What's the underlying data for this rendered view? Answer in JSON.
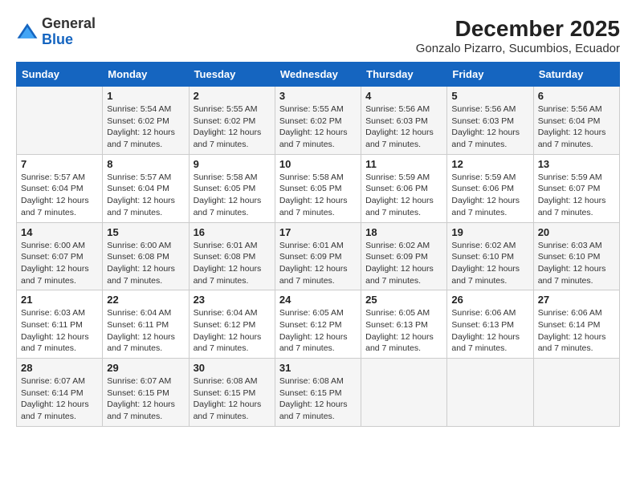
{
  "logo": {
    "general": "General",
    "blue": "Blue"
  },
  "header": {
    "month_year": "December 2025",
    "location": "Gonzalo Pizarro, Sucumbios, Ecuador"
  },
  "days_of_week": [
    "Sunday",
    "Monday",
    "Tuesday",
    "Wednesday",
    "Thursday",
    "Friday",
    "Saturday"
  ],
  "weeks": [
    [
      {
        "day": "",
        "sunrise": "",
        "sunset": "",
        "daylight": ""
      },
      {
        "day": "1",
        "sunrise": "Sunrise: 5:54 AM",
        "sunset": "Sunset: 6:02 PM",
        "daylight": "Daylight: 12 hours and 7 minutes."
      },
      {
        "day": "2",
        "sunrise": "Sunrise: 5:55 AM",
        "sunset": "Sunset: 6:02 PM",
        "daylight": "Daylight: 12 hours and 7 minutes."
      },
      {
        "day": "3",
        "sunrise": "Sunrise: 5:55 AM",
        "sunset": "Sunset: 6:02 PM",
        "daylight": "Daylight: 12 hours and 7 minutes."
      },
      {
        "day": "4",
        "sunrise": "Sunrise: 5:56 AM",
        "sunset": "Sunset: 6:03 PM",
        "daylight": "Daylight: 12 hours and 7 minutes."
      },
      {
        "day": "5",
        "sunrise": "Sunrise: 5:56 AM",
        "sunset": "Sunset: 6:03 PM",
        "daylight": "Daylight: 12 hours and 7 minutes."
      },
      {
        "day": "6",
        "sunrise": "Sunrise: 5:56 AM",
        "sunset": "Sunset: 6:04 PM",
        "daylight": "Daylight: 12 hours and 7 minutes."
      }
    ],
    [
      {
        "day": "7",
        "sunrise": "Sunrise: 5:57 AM",
        "sunset": "Sunset: 6:04 PM",
        "daylight": "Daylight: 12 hours and 7 minutes."
      },
      {
        "day": "8",
        "sunrise": "Sunrise: 5:57 AM",
        "sunset": "Sunset: 6:04 PM",
        "daylight": "Daylight: 12 hours and 7 minutes."
      },
      {
        "day": "9",
        "sunrise": "Sunrise: 5:58 AM",
        "sunset": "Sunset: 6:05 PM",
        "daylight": "Daylight: 12 hours and 7 minutes."
      },
      {
        "day": "10",
        "sunrise": "Sunrise: 5:58 AM",
        "sunset": "Sunset: 6:05 PM",
        "daylight": "Daylight: 12 hours and 7 minutes."
      },
      {
        "day": "11",
        "sunrise": "Sunrise: 5:59 AM",
        "sunset": "Sunset: 6:06 PM",
        "daylight": "Daylight: 12 hours and 7 minutes."
      },
      {
        "day": "12",
        "sunrise": "Sunrise: 5:59 AM",
        "sunset": "Sunset: 6:06 PM",
        "daylight": "Daylight: 12 hours and 7 minutes."
      },
      {
        "day": "13",
        "sunrise": "Sunrise: 5:59 AM",
        "sunset": "Sunset: 6:07 PM",
        "daylight": "Daylight: 12 hours and 7 minutes."
      }
    ],
    [
      {
        "day": "14",
        "sunrise": "Sunrise: 6:00 AM",
        "sunset": "Sunset: 6:07 PM",
        "daylight": "Daylight: 12 hours and 7 minutes."
      },
      {
        "day": "15",
        "sunrise": "Sunrise: 6:00 AM",
        "sunset": "Sunset: 6:08 PM",
        "daylight": "Daylight: 12 hours and 7 minutes."
      },
      {
        "day": "16",
        "sunrise": "Sunrise: 6:01 AM",
        "sunset": "Sunset: 6:08 PM",
        "daylight": "Daylight: 12 hours and 7 minutes."
      },
      {
        "day": "17",
        "sunrise": "Sunrise: 6:01 AM",
        "sunset": "Sunset: 6:09 PM",
        "daylight": "Daylight: 12 hours and 7 minutes."
      },
      {
        "day": "18",
        "sunrise": "Sunrise: 6:02 AM",
        "sunset": "Sunset: 6:09 PM",
        "daylight": "Daylight: 12 hours and 7 minutes."
      },
      {
        "day": "19",
        "sunrise": "Sunrise: 6:02 AM",
        "sunset": "Sunset: 6:10 PM",
        "daylight": "Daylight: 12 hours and 7 minutes."
      },
      {
        "day": "20",
        "sunrise": "Sunrise: 6:03 AM",
        "sunset": "Sunset: 6:10 PM",
        "daylight": "Daylight: 12 hours and 7 minutes."
      }
    ],
    [
      {
        "day": "21",
        "sunrise": "Sunrise: 6:03 AM",
        "sunset": "Sunset: 6:11 PM",
        "daylight": "Daylight: 12 hours and 7 minutes."
      },
      {
        "day": "22",
        "sunrise": "Sunrise: 6:04 AM",
        "sunset": "Sunset: 6:11 PM",
        "daylight": "Daylight: 12 hours and 7 minutes."
      },
      {
        "day": "23",
        "sunrise": "Sunrise: 6:04 AM",
        "sunset": "Sunset: 6:12 PM",
        "daylight": "Daylight: 12 hours and 7 minutes."
      },
      {
        "day": "24",
        "sunrise": "Sunrise: 6:05 AM",
        "sunset": "Sunset: 6:12 PM",
        "daylight": "Daylight: 12 hours and 7 minutes."
      },
      {
        "day": "25",
        "sunrise": "Sunrise: 6:05 AM",
        "sunset": "Sunset: 6:13 PM",
        "daylight": "Daylight: 12 hours and 7 minutes."
      },
      {
        "day": "26",
        "sunrise": "Sunrise: 6:06 AM",
        "sunset": "Sunset: 6:13 PM",
        "daylight": "Daylight: 12 hours and 7 minutes."
      },
      {
        "day": "27",
        "sunrise": "Sunrise: 6:06 AM",
        "sunset": "Sunset: 6:14 PM",
        "daylight": "Daylight: 12 hours and 7 minutes."
      }
    ],
    [
      {
        "day": "28",
        "sunrise": "Sunrise: 6:07 AM",
        "sunset": "Sunset: 6:14 PM",
        "daylight": "Daylight: 12 hours and 7 minutes."
      },
      {
        "day": "29",
        "sunrise": "Sunrise: 6:07 AM",
        "sunset": "Sunset: 6:15 PM",
        "daylight": "Daylight: 12 hours and 7 minutes."
      },
      {
        "day": "30",
        "sunrise": "Sunrise: 6:08 AM",
        "sunset": "Sunset: 6:15 PM",
        "daylight": "Daylight: 12 hours and 7 minutes."
      },
      {
        "day": "31",
        "sunrise": "Sunrise: 6:08 AM",
        "sunset": "Sunset: 6:15 PM",
        "daylight": "Daylight: 12 hours and 7 minutes."
      },
      {
        "day": "",
        "sunrise": "",
        "sunset": "",
        "daylight": ""
      },
      {
        "day": "",
        "sunrise": "",
        "sunset": "",
        "daylight": ""
      },
      {
        "day": "",
        "sunrise": "",
        "sunset": "",
        "daylight": ""
      }
    ]
  ]
}
